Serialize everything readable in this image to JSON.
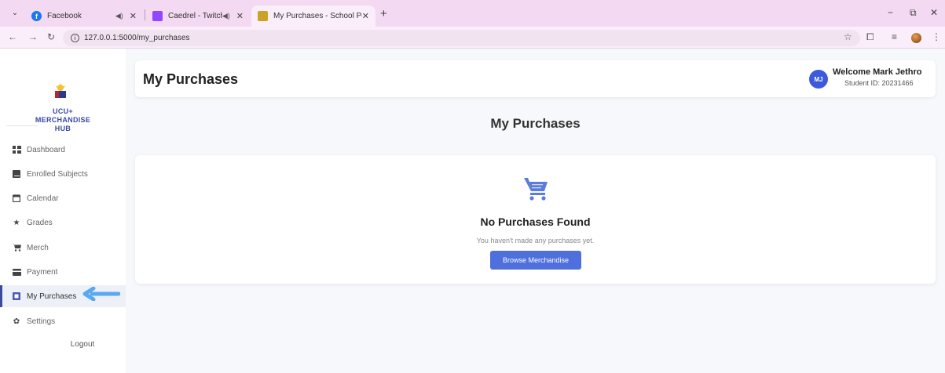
{
  "browser": {
    "tabs": [
      {
        "title": "Facebook",
        "favicon": "facebook-icon",
        "color": "#1877f2"
      },
      {
        "title": "Caedrel - Twitch",
        "favicon": "twitch-icon",
        "color": "#9146ff"
      },
      {
        "title": "My Purchases - School Portal",
        "favicon": "school-portal-icon",
        "color": "#c9a227"
      }
    ],
    "url": "127.0.0.1:5000/my_purchases"
  },
  "sidebar": {
    "brand": "UCU+\nMERCHANDISE\nHUB",
    "items": [
      {
        "label": "Dashboard",
        "icon": "dashboard-icon"
      },
      {
        "label": "Enrolled Subjects",
        "icon": "book-icon"
      },
      {
        "label": "Calendar",
        "icon": "calendar-icon"
      },
      {
        "label": "Grades",
        "icon": "star-icon"
      },
      {
        "label": "Merch",
        "icon": "cart-icon"
      },
      {
        "label": "Payment",
        "icon": "credit-card-icon"
      },
      {
        "label": "My Purchases",
        "icon": "receipt-icon"
      },
      {
        "label": "Settings",
        "icon": "gear-icon"
      }
    ],
    "active": "My Purchases",
    "logout": "Logout"
  },
  "header": {
    "title": "My Purchases",
    "avatar_initials": "MJ",
    "welcome": "Welcome Mark Jethro",
    "student_id": "Student ID: 20231466"
  },
  "main": {
    "title": "My Purchases",
    "empty_title": "No Purchases Found",
    "empty_subtitle": "You haven't made any purchases yet.",
    "browse_button": "Browse Merchandise"
  },
  "colors": {
    "accent": "#4e6fdc",
    "brand": "#3b4aa0",
    "cart": "#5b7be0",
    "annotation_arrow": "#5aa9f0"
  }
}
